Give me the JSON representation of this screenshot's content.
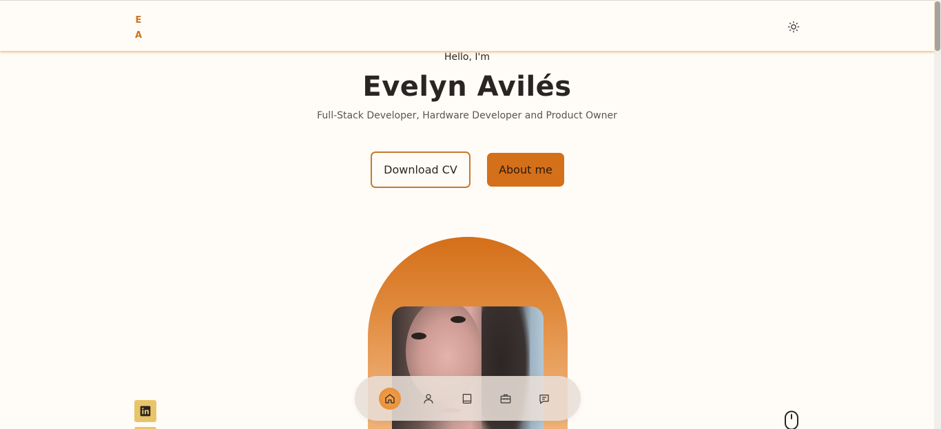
{
  "header": {
    "logo_line1": "E",
    "logo_line2": "A",
    "theme_icon": "sun-icon"
  },
  "hero": {
    "greeting": "Hello, I'm",
    "name": "Evelyn Avilés",
    "role": "Full-Stack Developer, Hardware Developer and Product Owner",
    "buttons": {
      "download_cv": "Download CV",
      "about_me": "About me"
    }
  },
  "dock": {
    "items": [
      {
        "icon": "home-icon",
        "active": true
      },
      {
        "icon": "user-icon",
        "active": false
      },
      {
        "icon": "book-icon",
        "active": false
      },
      {
        "icon": "briefcase-icon",
        "active": false
      },
      {
        "icon": "message-icon",
        "active": false
      }
    ]
  },
  "social": {
    "icon": "linkedin-icon"
  },
  "scroll_indicator": {
    "icon": "mouse-icon"
  },
  "colors": {
    "accent": "#d46f1a",
    "background": "#fffcf8",
    "text": "#2a2522",
    "social_bg": "#e9c56a"
  }
}
